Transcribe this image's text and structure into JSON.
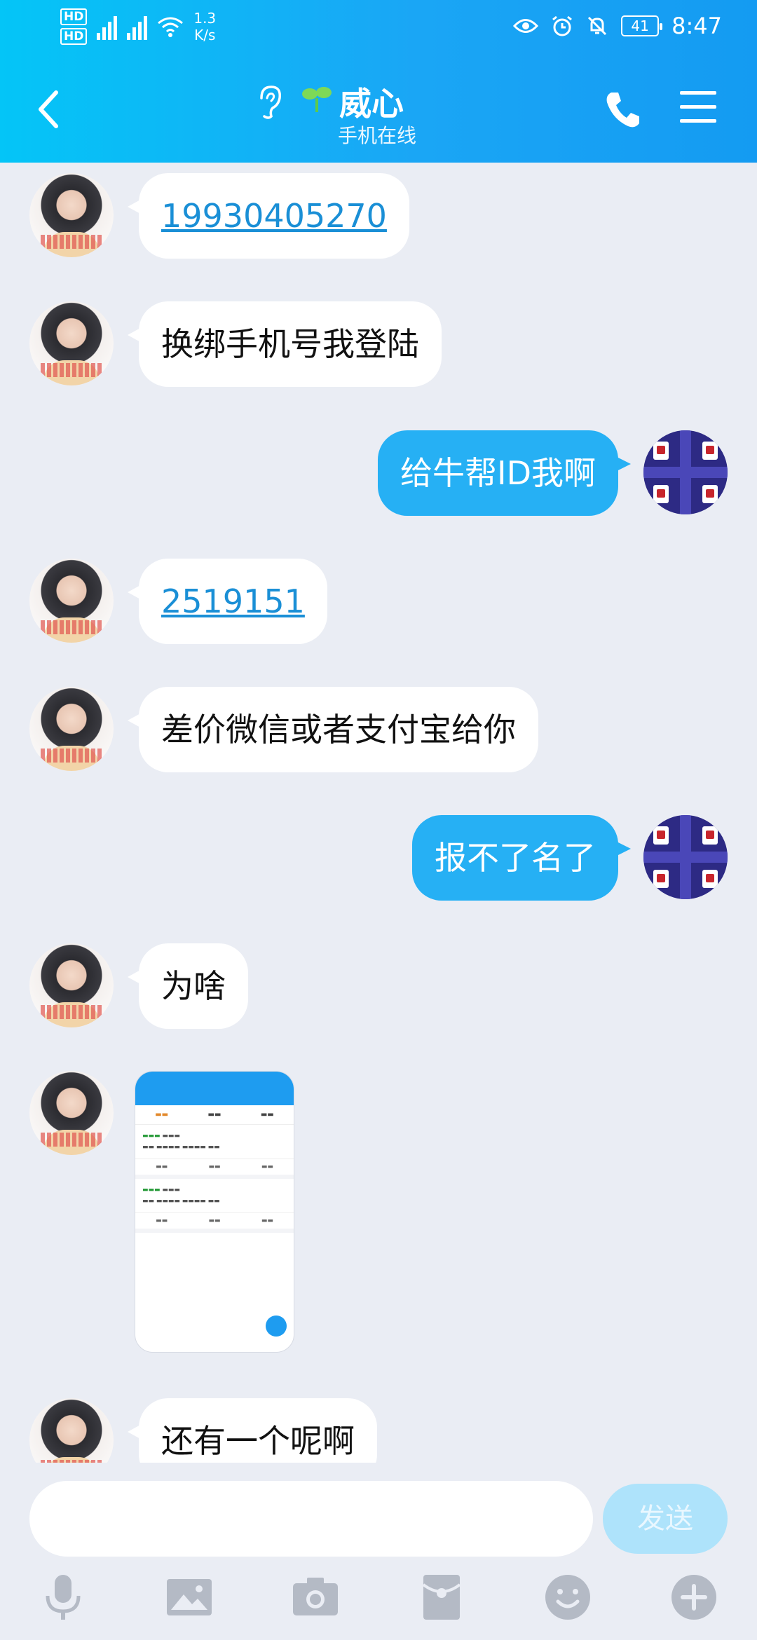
{
  "status_bar": {
    "speed_value": "1.3",
    "speed_unit": "K/s",
    "battery": "41",
    "time": "8:47"
  },
  "header": {
    "title": "威心",
    "subtitle": "手机在线"
  },
  "messages": [
    {
      "side": "left",
      "text": "19930405270",
      "link": true
    },
    {
      "side": "left",
      "text": "换绑手机号我登陆"
    },
    {
      "side": "right",
      "text": "给牛帮ID我啊"
    },
    {
      "side": "left",
      "text": "2519151",
      "link": true
    },
    {
      "side": "left",
      "text": "差价微信或者支付宝给你"
    },
    {
      "side": "right",
      "text": "报不了名了"
    },
    {
      "side": "left",
      "text": "为啥"
    },
    {
      "side": "left",
      "text": "还有一个呢啊"
    }
  ],
  "input_bar": {
    "send_label": "发送"
  },
  "toolbar": {
    "icons": [
      "microphone-icon",
      "image-icon",
      "camera-icon",
      "red-packet-icon",
      "emoji-icon",
      "plus-icon"
    ]
  },
  "colors": {
    "header_start": "#04c5f7",
    "header_end": "#149bf2",
    "bubble_self": "#26b0f4",
    "bubble_other": "#ffffff",
    "link": "#1a8fd6",
    "background": "#eaedf4"
  }
}
